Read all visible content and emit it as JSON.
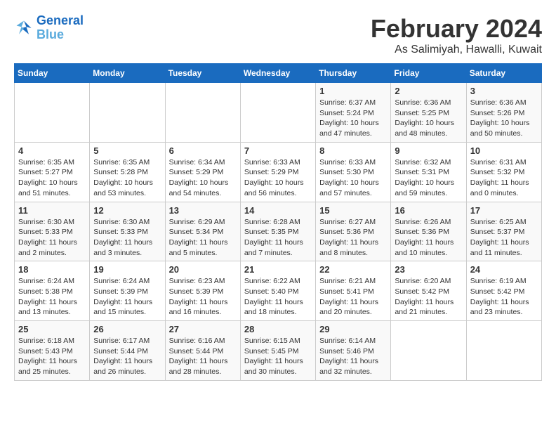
{
  "logo": {
    "line1": "General",
    "line2": "Blue"
  },
  "title": "February 2024",
  "subtitle": "As Salimiyah, Hawalli, Kuwait",
  "days_header": [
    "Sunday",
    "Monday",
    "Tuesday",
    "Wednesday",
    "Thursday",
    "Friday",
    "Saturday"
  ],
  "weeks": [
    [
      {
        "day": "",
        "info": ""
      },
      {
        "day": "",
        "info": ""
      },
      {
        "day": "",
        "info": ""
      },
      {
        "day": "",
        "info": ""
      },
      {
        "day": "1",
        "info": "Sunrise: 6:37 AM\nSunset: 5:24 PM\nDaylight: 10 hours\nand 47 minutes."
      },
      {
        "day": "2",
        "info": "Sunrise: 6:36 AM\nSunset: 5:25 PM\nDaylight: 10 hours\nand 48 minutes."
      },
      {
        "day": "3",
        "info": "Sunrise: 6:36 AM\nSunset: 5:26 PM\nDaylight: 10 hours\nand 50 minutes."
      }
    ],
    [
      {
        "day": "4",
        "info": "Sunrise: 6:35 AM\nSunset: 5:27 PM\nDaylight: 10 hours\nand 51 minutes."
      },
      {
        "day": "5",
        "info": "Sunrise: 6:35 AM\nSunset: 5:28 PM\nDaylight: 10 hours\nand 53 minutes."
      },
      {
        "day": "6",
        "info": "Sunrise: 6:34 AM\nSunset: 5:29 PM\nDaylight: 10 hours\nand 54 minutes."
      },
      {
        "day": "7",
        "info": "Sunrise: 6:33 AM\nSunset: 5:29 PM\nDaylight: 10 hours\nand 56 minutes."
      },
      {
        "day": "8",
        "info": "Sunrise: 6:33 AM\nSunset: 5:30 PM\nDaylight: 10 hours\nand 57 minutes."
      },
      {
        "day": "9",
        "info": "Sunrise: 6:32 AM\nSunset: 5:31 PM\nDaylight: 10 hours\nand 59 minutes."
      },
      {
        "day": "10",
        "info": "Sunrise: 6:31 AM\nSunset: 5:32 PM\nDaylight: 11 hours\nand 0 minutes."
      }
    ],
    [
      {
        "day": "11",
        "info": "Sunrise: 6:30 AM\nSunset: 5:33 PM\nDaylight: 11 hours\nand 2 minutes."
      },
      {
        "day": "12",
        "info": "Sunrise: 6:30 AM\nSunset: 5:33 PM\nDaylight: 11 hours\nand 3 minutes."
      },
      {
        "day": "13",
        "info": "Sunrise: 6:29 AM\nSunset: 5:34 PM\nDaylight: 11 hours\nand 5 minutes."
      },
      {
        "day": "14",
        "info": "Sunrise: 6:28 AM\nSunset: 5:35 PM\nDaylight: 11 hours\nand 7 minutes."
      },
      {
        "day": "15",
        "info": "Sunrise: 6:27 AM\nSunset: 5:36 PM\nDaylight: 11 hours\nand 8 minutes."
      },
      {
        "day": "16",
        "info": "Sunrise: 6:26 AM\nSunset: 5:36 PM\nDaylight: 11 hours\nand 10 minutes."
      },
      {
        "day": "17",
        "info": "Sunrise: 6:25 AM\nSunset: 5:37 PM\nDaylight: 11 hours\nand 11 minutes."
      }
    ],
    [
      {
        "day": "18",
        "info": "Sunrise: 6:24 AM\nSunset: 5:38 PM\nDaylight: 11 hours\nand 13 minutes."
      },
      {
        "day": "19",
        "info": "Sunrise: 6:24 AM\nSunset: 5:39 PM\nDaylight: 11 hours\nand 15 minutes."
      },
      {
        "day": "20",
        "info": "Sunrise: 6:23 AM\nSunset: 5:39 PM\nDaylight: 11 hours\nand 16 minutes."
      },
      {
        "day": "21",
        "info": "Sunrise: 6:22 AM\nSunset: 5:40 PM\nDaylight: 11 hours\nand 18 minutes."
      },
      {
        "day": "22",
        "info": "Sunrise: 6:21 AM\nSunset: 5:41 PM\nDaylight: 11 hours\nand 20 minutes."
      },
      {
        "day": "23",
        "info": "Sunrise: 6:20 AM\nSunset: 5:42 PM\nDaylight: 11 hours\nand 21 minutes."
      },
      {
        "day": "24",
        "info": "Sunrise: 6:19 AM\nSunset: 5:42 PM\nDaylight: 11 hours\nand 23 minutes."
      }
    ],
    [
      {
        "day": "25",
        "info": "Sunrise: 6:18 AM\nSunset: 5:43 PM\nDaylight: 11 hours\nand 25 minutes."
      },
      {
        "day": "26",
        "info": "Sunrise: 6:17 AM\nSunset: 5:44 PM\nDaylight: 11 hours\nand 26 minutes."
      },
      {
        "day": "27",
        "info": "Sunrise: 6:16 AM\nSunset: 5:44 PM\nDaylight: 11 hours\nand 28 minutes."
      },
      {
        "day": "28",
        "info": "Sunrise: 6:15 AM\nSunset: 5:45 PM\nDaylight: 11 hours\nand 30 minutes."
      },
      {
        "day": "29",
        "info": "Sunrise: 6:14 AM\nSunset: 5:46 PM\nDaylight: 11 hours\nand 32 minutes."
      },
      {
        "day": "",
        "info": ""
      },
      {
        "day": "",
        "info": ""
      }
    ]
  ]
}
